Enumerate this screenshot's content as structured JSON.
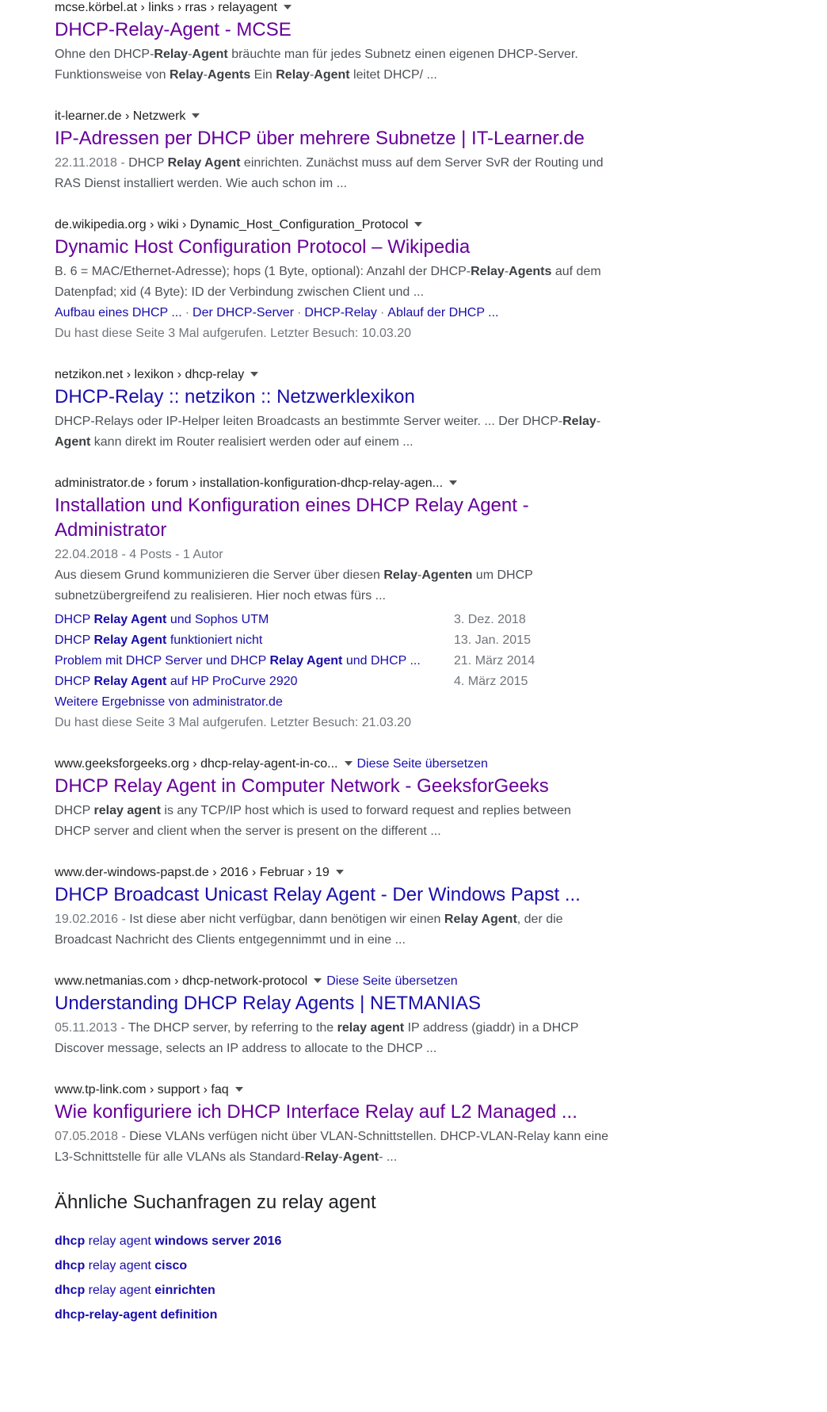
{
  "results": [
    {
      "cite": "mcse.körbel.at › links › rras › relayagent",
      "title": "DHCP-Relay-Agent - MCSE",
      "visited": true,
      "date": "",
      "snippet_parts": [
        {
          "t": "Ohne den DHCP-"
        },
        {
          "t": "Relay",
          "b": true
        },
        {
          "t": "-"
        },
        {
          "t": "Agent",
          "b": true
        },
        {
          "t": " bräuchte man für jedes Subnetz einen eigenen DHCP-Server. Funktionsweise von "
        },
        {
          "t": "Relay",
          "b": true
        },
        {
          "t": "-"
        },
        {
          "t": "Agents",
          "b": true
        },
        {
          "t": " Ein "
        },
        {
          "t": "Relay",
          "b": true
        },
        {
          "t": "-"
        },
        {
          "t": "Agent",
          "b": true
        },
        {
          "t": " leitet DHCP/ ..."
        }
      ]
    },
    {
      "cite": "it-learner.de › Netzwerk",
      "title": "IP-Adressen per DHCP über mehrere Subnetze | IT-Learner.de",
      "visited": true,
      "date": "22.11.2018 - ",
      "snippet_parts": [
        {
          "t": "DHCP "
        },
        {
          "t": "Relay Agent",
          "b": true
        },
        {
          "t": " einrichten. Zunächst muss auf dem Server SvR der Routing und RAS Dienst installiert werden. Wie auch schon im ..."
        }
      ]
    },
    {
      "cite": "de.wikipedia.org › wiki › Dynamic_Host_Configuration_Protocol",
      "title": "Dynamic Host Configuration Protocol – Wikipedia",
      "visited": true,
      "date": "",
      "snippet_parts": [
        {
          "t": "B. 6 = MAC/Ethernet-Adresse); hops (1 Byte, optional): Anzahl der DHCP-"
        },
        {
          "t": "Relay",
          "b": true
        },
        {
          "t": "-"
        },
        {
          "t": "Agents",
          "b": true
        },
        {
          "t": " auf dem Datenpfad; xid (4 Byte): ID der Verbindung zwischen Client und ..."
        }
      ],
      "sitelinks": [
        "Aufbau eines DHCP ...",
        "Der DHCP-Server",
        "DHCP-Relay",
        "Ablauf der DHCP ..."
      ],
      "visited_note": "Du hast diese Seite 3 Mal aufgerufen. Letzter Besuch: 10.03.20"
    },
    {
      "cite": "netzikon.net › lexikon › dhcp-relay",
      "title": "DHCP-Relay :: netzikon :: Netzwerklexikon",
      "visited": false,
      "date": "",
      "snippet_parts": [
        {
          "t": "DHCP-Relays oder IP-Helper leiten Broadcasts an bestimmte Server weiter. ... Der DHCP-"
        },
        {
          "t": "Relay",
          "b": true
        },
        {
          "t": "-"
        },
        {
          "t": "Agent",
          "b": true
        },
        {
          "t": " kann direkt im Router realisiert werden oder auf einem ..."
        }
      ]
    },
    {
      "cite": "administrator.de › forum › installation-konfiguration-dhcp-relay-agen...",
      "title": "Installation und Konfiguration eines DHCP Relay Agent - Administrator",
      "visited": true,
      "date": "",
      "meta": "22.04.2018 - 4 Posts - 1 Autor",
      "snippet_parts": [
        {
          "t": "Aus diesem Grund kommunizieren die Server über diesen "
        },
        {
          "t": "Relay",
          "b": true
        },
        {
          "t": "-"
        },
        {
          "t": "Agenten",
          "b": true
        },
        {
          "t": " um DHCP subnetzübergreifend zu realisieren. Hier noch etwas fürs ..."
        }
      ],
      "subresults": [
        {
          "parts": [
            {
              "t": "DHCP "
            },
            {
              "t": "Relay Agent",
              "b": true
            },
            {
              "t": " und Sophos UTM"
            }
          ],
          "date": "3. Dez. 2018"
        },
        {
          "parts": [
            {
              "t": "DHCP "
            },
            {
              "t": "Relay Agent",
              "b": true
            },
            {
              "t": " funktioniert nicht"
            }
          ],
          "date": "13. Jan. 2015"
        },
        {
          "parts": [
            {
              "t": "Problem mit DHCP Server und DHCP "
            },
            {
              "t": "Relay Agent",
              "b": true
            },
            {
              "t": " und DHCP ..."
            }
          ],
          "date": "21. März 2014"
        },
        {
          "parts": [
            {
              "t": "DHCP "
            },
            {
              "t": "Relay Agent",
              "b": true
            },
            {
              "t": " auf HP ProCurve 2920"
            }
          ],
          "date": "4. März 2015"
        }
      ],
      "more_results": "Weitere Ergebnisse von administrator.de",
      "visited_note": "Du hast diese Seite 3 Mal aufgerufen. Letzter Besuch: 21.03.20"
    },
    {
      "cite": "www.geeksforgeeks.org › dhcp-relay-agent-in-co...",
      "translate": "Diese Seite übersetzen",
      "title": "DHCP Relay Agent in Computer Network - GeeksforGeeks",
      "visited": true,
      "date": "",
      "snippet_parts": [
        {
          "t": "DHCP "
        },
        {
          "t": "relay agent",
          "b": true
        },
        {
          "t": " is any TCP/IP host which is used to forward request and replies between DHCP server and client when the server is present on the different ..."
        }
      ]
    },
    {
      "cite": "www.der-windows-papst.de › 2016 › Februar › 19",
      "title": "DHCP Broadcast Unicast Relay Agent - Der Windows Papst ...",
      "visited": false,
      "date": "19.02.2016 - ",
      "snippet_parts": [
        {
          "t": "Ist diese aber nicht verfügbar, dann benötigen wir einen "
        },
        {
          "t": "Relay Agent",
          "b": true
        },
        {
          "t": ", der die Broadcast Nachricht des Clients entgegennimmt und in eine ..."
        }
      ]
    },
    {
      "cite": "www.netmanias.com › dhcp-network-protocol",
      "translate": "Diese Seite übersetzen",
      "title": "Understanding DHCP Relay Agents | NETMANIAS",
      "visited": false,
      "date": "05.11.2013 - ",
      "snippet_parts": [
        {
          "t": "The DHCP server, by referring to the "
        },
        {
          "t": "relay agent",
          "b": true
        },
        {
          "t": " IP address (giaddr) in a DHCP Discover message, selects an IP address to allocate to the DHCP ..."
        }
      ]
    },
    {
      "cite": "www.tp-link.com › support › faq",
      "title": "Wie konfiguriere ich DHCP Interface Relay auf L2 Managed ...",
      "visited": true,
      "date": "07.05.2018 - ",
      "snippet_parts": [
        {
          "t": "Diese VLANs verfügen nicht über VLAN-Schnittstellen. DHCP-VLAN-Relay kann eine L3-Schnittstelle für alle VLANs als Standard-"
        },
        {
          "t": "Relay",
          "b": true
        },
        {
          "t": "-"
        },
        {
          "t": "Agent",
          "b": true
        },
        {
          "t": "- ..."
        }
      ]
    }
  ],
  "related": {
    "heading": "Ähnliche Suchanfragen zu relay agent",
    "items": [
      [
        {
          "t": "dhcp",
          "b": true
        },
        {
          "t": " relay agent "
        },
        {
          "t": "windows server 2016",
          "b": true
        }
      ],
      [
        {
          "t": "dhcp",
          "b": true
        },
        {
          "t": " relay agent "
        },
        {
          "t": "cisco",
          "b": true
        }
      ],
      [
        {
          "t": "dhcp",
          "b": true
        },
        {
          "t": " relay agent "
        },
        {
          "t": "einrichten",
          "b": true
        }
      ],
      [
        {
          "t": "dhcp-relay-agent definition",
          "b": true
        }
      ]
    ]
  }
}
